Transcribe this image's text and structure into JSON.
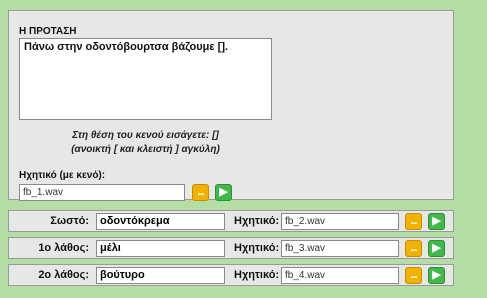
{
  "sentence_panel": {
    "title": "Η ΠΡΟΤΑΣΗ",
    "sentence": "Πάνω στην οδοντόβουρτσα βάζουμε [].",
    "hint_line1": "Στη θέση του κενού εισάγετε: []",
    "hint_line2": "(ανοικτή [ και κλειστή ] αγκύλη)",
    "audio_label": "Ηχητικό (με κενό):",
    "audio_file": "fb_1.wav"
  },
  "answers": [
    {
      "label": "Σωστό:",
      "value": "οδοντόκρεμα",
      "audio_label": "Ηχητικό:",
      "audio_file": "fb_2.wav"
    },
    {
      "label": "1ο λάθος:",
      "value": "μέλι",
      "audio_label": "Ηχητικό:",
      "audio_file": "fb_3.wav"
    },
    {
      "label": "2ο λάθος:",
      "value": "βούτυρο",
      "audio_label": "Ηχητικό:",
      "audio_file": "fb_4.wav"
    }
  ],
  "buttons": {
    "browse_glyph": "...",
    "play_glyph": "▶"
  },
  "colors": {
    "background": "#b5dea6",
    "browse": "#f1b300",
    "play": "#41b94a"
  }
}
